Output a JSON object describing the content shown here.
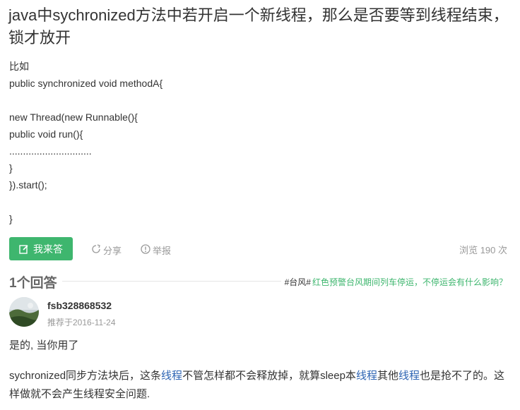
{
  "question": {
    "title": "java中sychronized方法中若开启一个新线程，那么是否要等到线程结束，锁才放开",
    "body_lines": [
      "比如",
      "public synchronized void methodA{",
      "",
      "new Thread(new Runnable(){",
      "public void run(){",
      "..............................",
      "}",
      "}).start();",
      "",
      "}"
    ]
  },
  "actions": {
    "answer_label": "我来答",
    "share_label": "分享",
    "report_label": "举报",
    "views_text": "浏览 190 次"
  },
  "answers_header": "1个回答",
  "news": {
    "tag": "#台风#",
    "text": "红色预警台风期间列车停运，不停运会有什么影响？"
  },
  "answer": {
    "username": "fsb328868532",
    "recommended": "推荐于2016-11-24",
    "paragraph1": "是的, 当你用了",
    "p2_parts": [
      "sychronized同步方法块后，这条",
      "线程",
      "不管怎样都不会释放掉，就算sleep本",
      "线程",
      "其他",
      "线程",
      "也是抢不了的。这样做就不会产生线程安全问题."
    ]
  },
  "colors": {
    "accent": "#3eb66e",
    "link": "#2d64b3",
    "muted": "#999999"
  }
}
